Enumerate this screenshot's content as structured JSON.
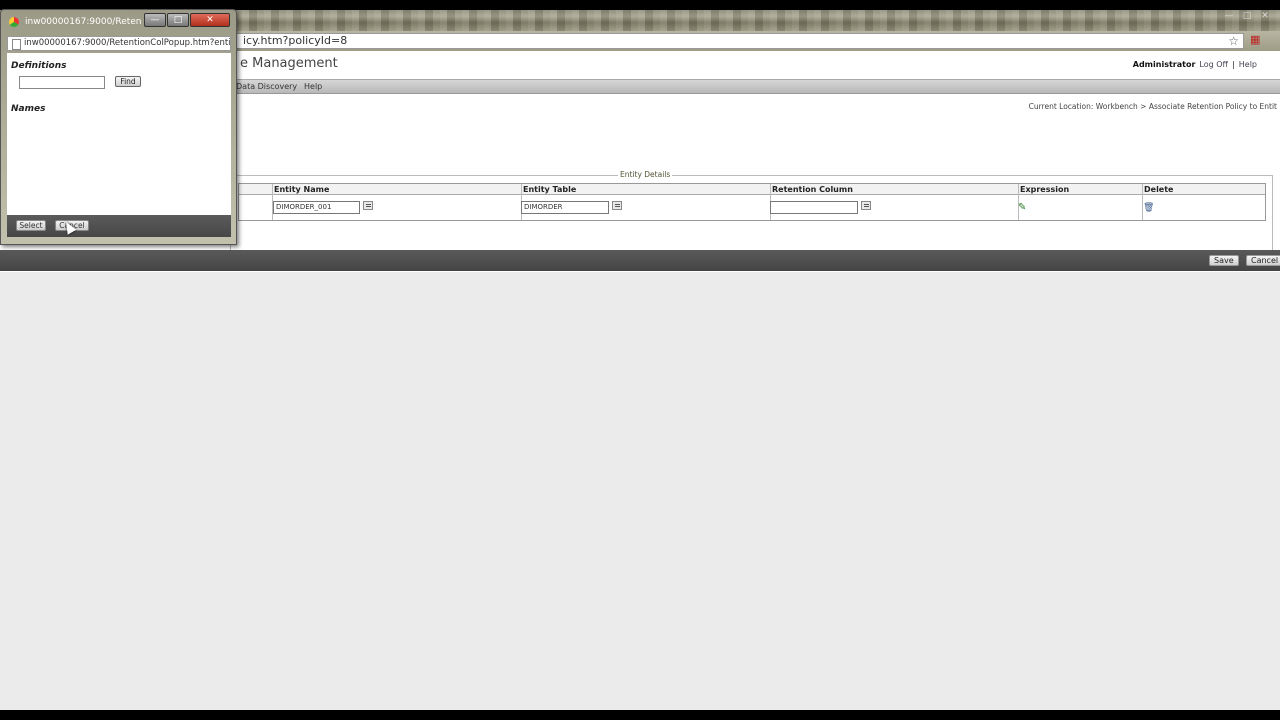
{
  "browser": {
    "address": "icy.htm?policyId=8"
  },
  "header": {
    "app_title": "e Management",
    "user": "Administrator",
    "log_off": "Log Off",
    "separator": "|",
    "help": "Help"
  },
  "menu": {
    "items": [
      "Data Discovery",
      "Help"
    ]
  },
  "location": "Current Location: Workbench > Associate Retention Policy to Entit",
  "entity_details": {
    "legend": "Entity Details",
    "columns": [
      "Entity Name",
      "Entity Table",
      "Retention Column",
      "Expression",
      "Delete"
    ],
    "row": {
      "entity_name": "DIMORDER_001",
      "entity_table": "DIMORDER",
      "retention_column": ""
    }
  },
  "footer": {
    "save": "Save",
    "cancel": "Cancel"
  },
  "popup": {
    "title": "inw00000167:9000/Reten...",
    "address": "inw00000167:9000/RetentionColPopup.htm?enti",
    "definitions_label": "Definitions",
    "definitions_value": "",
    "find": "Find",
    "names_label": "Names",
    "select": "Select",
    "cancel": "Cancel"
  },
  "colors": {
    "footer_bar": "#4a4a4a",
    "page_bg": "#ebebeb",
    "close_button": "#c0392b"
  }
}
